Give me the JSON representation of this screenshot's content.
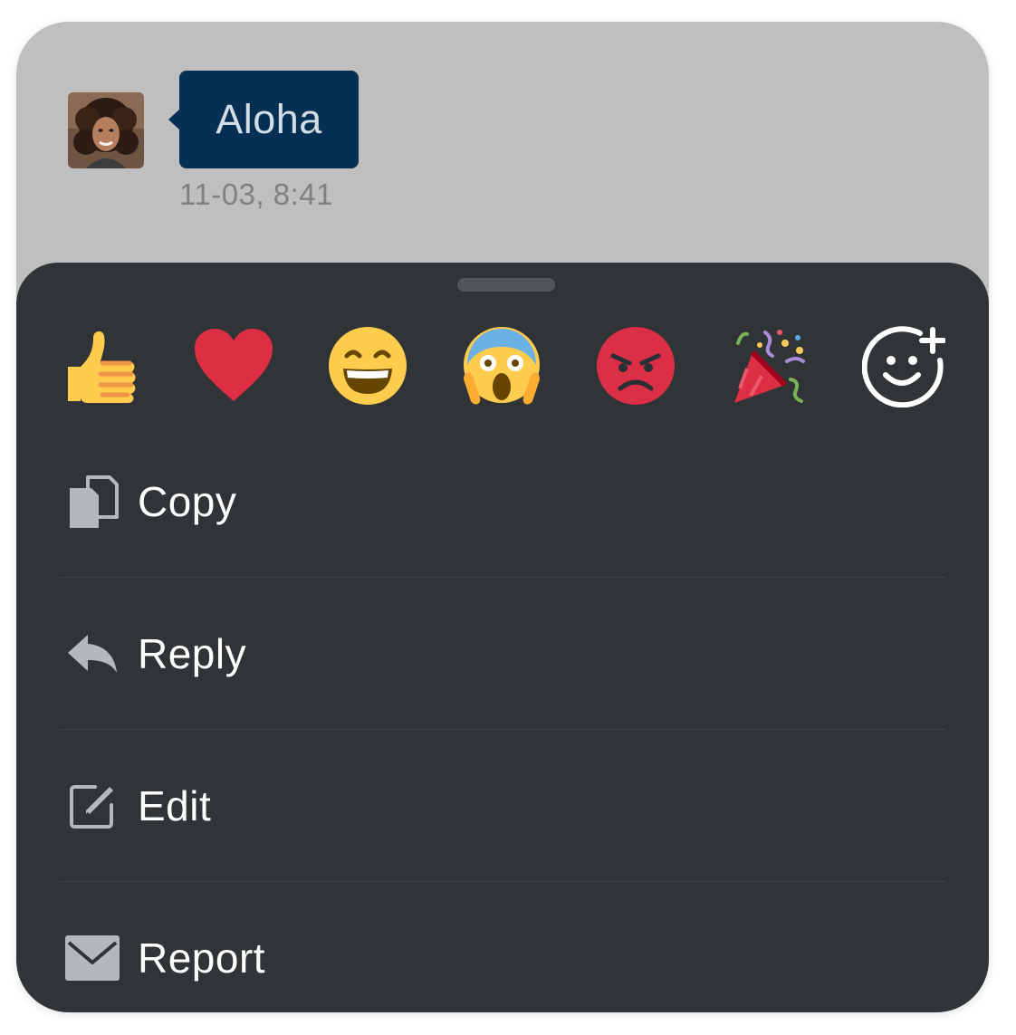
{
  "message": {
    "avatar": {
      "icon": "avatar-photo"
    },
    "text": "Aloha",
    "timestamp": "11-03, 8:41",
    "colors": {
      "bubble": "#052f53",
      "text": "#d4dde6"
    }
  },
  "sheet": {
    "colors": {
      "background": "#303437",
      "handle": "#51565b",
      "divider": "#41464a"
    },
    "reactions": [
      {
        "name": "thumbs-up",
        "icon": "thumbs-up-emoji"
      },
      {
        "name": "heart",
        "icon": "red-heart-emoji"
      },
      {
        "name": "grin",
        "icon": "grinning-face-emoji"
      },
      {
        "name": "scream",
        "icon": "screaming-face-emoji"
      },
      {
        "name": "angry",
        "icon": "angry-face-emoji"
      },
      {
        "name": "party",
        "icon": "party-popper-emoji"
      },
      {
        "name": "add-reaction",
        "icon": "add-reaction-icon"
      }
    ],
    "menu": [
      {
        "label": "Copy",
        "icon": "copy-icon"
      },
      {
        "label": "Reply",
        "icon": "reply-icon"
      },
      {
        "label": "Edit",
        "icon": "edit-icon"
      },
      {
        "label": "Report",
        "icon": "envelope-icon"
      }
    ]
  }
}
